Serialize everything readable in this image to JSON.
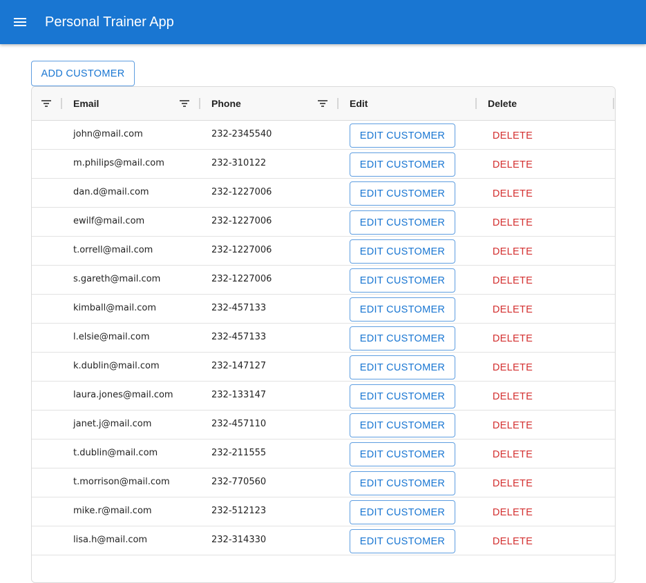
{
  "app": {
    "title": "Personal Trainer App",
    "menu_icon": "menu-icon",
    "primary_color": "#1976d2",
    "delete_color": "#d32f2f"
  },
  "toolbar": {
    "add_label": "ADD CUSTOMER"
  },
  "table": {
    "columns": [
      {
        "label": "",
        "filter_icon": "filter-icon"
      },
      {
        "label": "Email",
        "filter_icon": "filter-icon"
      },
      {
        "label": "Phone",
        "filter_icon": "filter-icon"
      },
      {
        "label": "Edit"
      },
      {
        "label": "Delete"
      }
    ],
    "edit_label": "EDIT CUSTOMER",
    "delete_label": "DELETE",
    "rows": [
      {
        "email": "john@mail.com",
        "phone": "232-2345540"
      },
      {
        "email": "m.philips@mail.com",
        "phone": "232-310122"
      },
      {
        "email": "dan.d@mail.com",
        "phone": "232-1227006"
      },
      {
        "email": "ewilf@mail.com",
        "phone": "232-1227006"
      },
      {
        "email": "t.orrell@mail.com",
        "phone": "232-1227006"
      },
      {
        "email": "s.gareth@mail.com",
        "phone": "232-1227006"
      },
      {
        "email": "kimball@mail.com",
        "phone": "232-457133"
      },
      {
        "email": "l.elsie@mail.com",
        "phone": "232-457133"
      },
      {
        "email": "k.dublin@mail.com",
        "phone": "232-147127"
      },
      {
        "email": "laura.jones@mail.com",
        "phone": "232-133147"
      },
      {
        "email": "janet.j@mail.com",
        "phone": "232-457110"
      },
      {
        "email": "t.dublin@mail.com",
        "phone": "232-211555"
      },
      {
        "email": "t.morrison@mail.com",
        "phone": "232-770560"
      },
      {
        "email": "mike.r@mail.com",
        "phone": "232-512123"
      },
      {
        "email": "lisa.h@mail.com",
        "phone": "232-314330"
      }
    ]
  }
}
